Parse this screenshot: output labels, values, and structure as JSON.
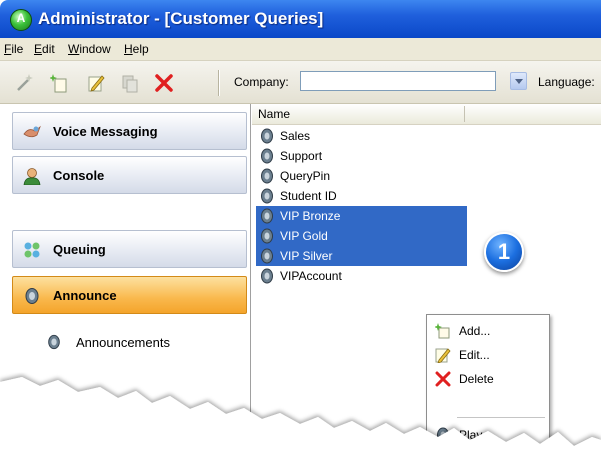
{
  "window": {
    "title": "Administrator - [Customer Queries]"
  },
  "menubar": {
    "items": [
      {
        "underline": "F",
        "rest": "ile"
      },
      {
        "underline": "E",
        "rest": "dit"
      },
      {
        "underline": "W",
        "rest": "indow"
      },
      {
        "underline": "H",
        "rest": "elp"
      }
    ]
  },
  "toolbar": {
    "company_label": "Company:",
    "company_value": "",
    "language_label": "Language:"
  },
  "nav": {
    "items": [
      {
        "label": "Voice Messaging",
        "icon": "voice-messaging-icon"
      },
      {
        "label": "Console",
        "icon": "console-user-icon"
      },
      {
        "label": "Queuing",
        "icon": "queuing-icon"
      },
      {
        "label": "Announce",
        "icon": "announce-icon",
        "active": true
      }
    ],
    "subitem": "Announcements"
  },
  "list": {
    "column_name": "Name",
    "rows": [
      {
        "label": "Sales",
        "selected": false
      },
      {
        "label": "Support",
        "selected": false
      },
      {
        "label": "QueryPin",
        "selected": false
      },
      {
        "label": "Student ID",
        "selected": false
      },
      {
        "label": "VIP Bronze",
        "selected": true
      },
      {
        "label": "VIP Gold",
        "selected": true
      },
      {
        "label": "VIP Silver",
        "selected": true
      },
      {
        "label": "VIPAccount",
        "selected": false
      }
    ]
  },
  "callout": {
    "number": "1"
  },
  "context_menu": {
    "items": [
      {
        "label": "Add...",
        "icon": "add-icon"
      },
      {
        "label": "Edit...",
        "icon": "edit-pencil-icon"
      },
      {
        "label": "Delete",
        "icon": "delete-x-icon"
      },
      {
        "label": "Play",
        "icon": "play-speaker-icon"
      }
    ]
  },
  "colors": {
    "titlebar": "#1f5fdc",
    "selection": "#3169c6",
    "active_nav": "#f9b84c",
    "delete_red": "#e02020"
  }
}
